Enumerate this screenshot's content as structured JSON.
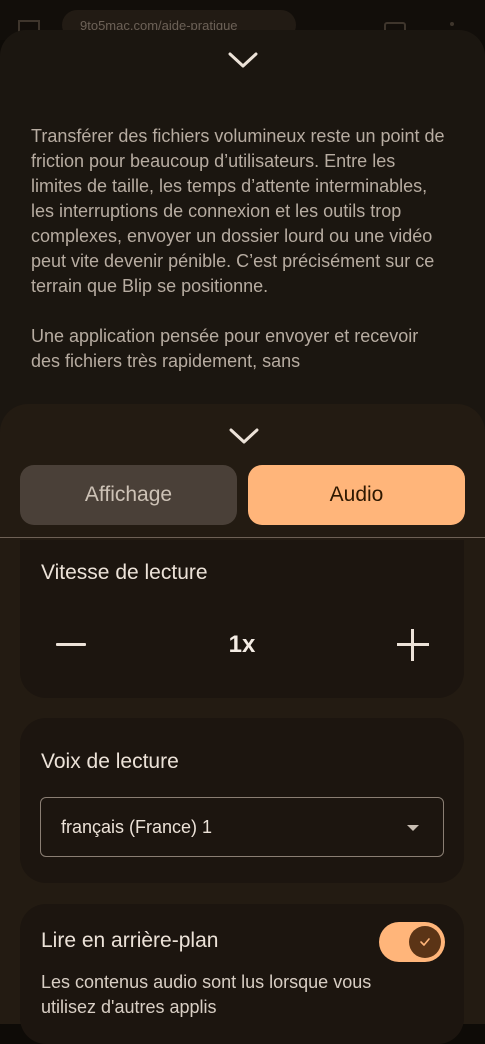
{
  "browser": {
    "url": "9to5mac.com/aide-pratique"
  },
  "reader": {
    "paragraphs": [
      "Transférer des fichiers volumineux reste un point de friction pour beaucoup d’utilisateurs. Entre les limites de taille, les temps d’attente interminables, les interruptions de connexion et les outils trop complexes, envoyer un dossier lourd ou une vidéo peut vite devenir pénible. C’est précisément sur ce terrain que Blip se positionne.",
      "Une application pensée pour envoyer et recevoir des fichiers très rapidement, sans"
    ]
  },
  "settings": {
    "tabs": [
      {
        "label": "Affichage",
        "selected": false
      },
      {
        "label": "Audio",
        "selected": true
      }
    ],
    "speed": {
      "title": "Vitesse de lecture",
      "value": "1x"
    },
    "voice": {
      "title": "Voix de lecture",
      "selected": "français (France) 1"
    },
    "background": {
      "title": "Lire en arrière-plan",
      "description": "Les contenus audio sont lus lorsque vous utilisez d'autres applis",
      "enabled": true
    }
  },
  "colors": {
    "accent": "#ffb57a",
    "sheet": "#231b12",
    "card": "#1c150f"
  }
}
